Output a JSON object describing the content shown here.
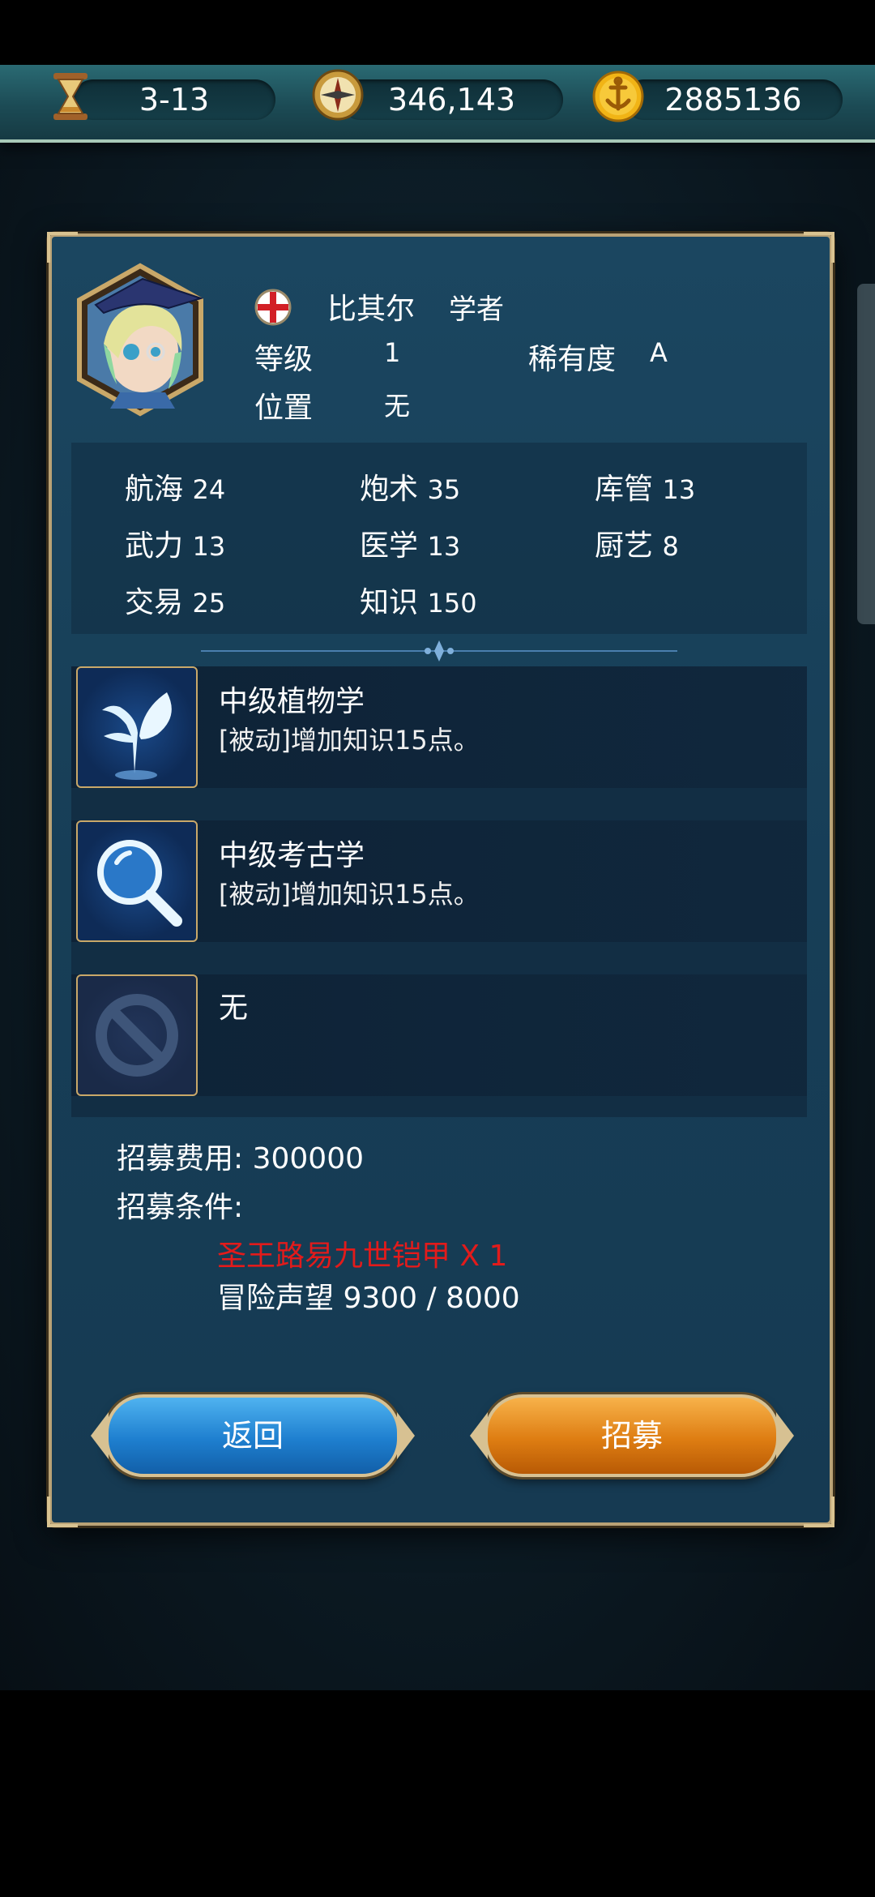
{
  "topbar": {
    "stage": "3-13",
    "compass_value": "346,143",
    "gold_value": "2885136",
    "icons": [
      "hourglass-icon",
      "compass-icon",
      "anchor-coin-icon"
    ]
  },
  "character": {
    "name": "比其尔",
    "job": "学者",
    "level_label": "等级",
    "level_value": "1",
    "rarity_label": "稀有度",
    "rarity_value": "A",
    "position_label": "位置",
    "position_value": "无"
  },
  "stats": [
    {
      "label": "航海",
      "value": "24"
    },
    {
      "label": "炮术",
      "value": "35"
    },
    {
      "label": "库管",
      "value": "13"
    },
    {
      "label": "武力",
      "value": "13"
    },
    {
      "label": "医学",
      "value": "13"
    },
    {
      "label": "厨艺",
      "value": "8"
    },
    {
      "label": "交易",
      "value": "25"
    },
    {
      "label": "知识",
      "value": "150"
    }
  ],
  "skills": [
    {
      "name": "中级植物学",
      "desc": "[被动]增加知识15点。",
      "icon": "plant-icon"
    },
    {
      "name": "中级考古学",
      "desc": "[被动]增加知识15点。",
      "icon": "magnifier-icon"
    },
    {
      "name": "无",
      "desc": "",
      "icon": "empty-slot-icon"
    }
  ],
  "recruit": {
    "cost_label": "招募费用: 300000",
    "condition_label": "招募条件:",
    "requirement_item": "圣王路易九世铠甲 X 1",
    "requirement_fame": "冒险声望 9300 / 8000"
  },
  "buttons": {
    "back": "返回",
    "recruit": "招募"
  },
  "colors": {
    "requirement_unmet": "#e21b1b",
    "panel_border": "#b9a276",
    "back_button": "#1e7fcf",
    "recruit_button": "#de7d12"
  }
}
